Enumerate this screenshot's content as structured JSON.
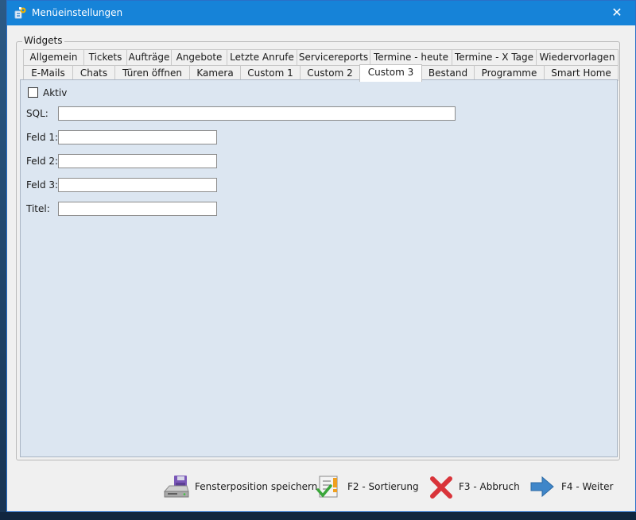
{
  "window": {
    "title": "Menüeinstellungen",
    "close_symbol": "✕"
  },
  "group": {
    "legend": "Widgets"
  },
  "tabs": {
    "row1": [
      "Allgemein",
      "Tickets",
      "Aufträge",
      "Angebote",
      "Letzte Anrufe",
      "Servicereports",
      "Termine - heute",
      "Termine - X Tage",
      "Wiedervorlagen"
    ],
    "row2": [
      "E-Mails",
      "Chats",
      "Türen öffnen",
      "Kamera",
      "Custom 1",
      "Custom 2",
      "Custom 3",
      "Bestand",
      "Programme",
      "Smart Home"
    ],
    "active": "Custom 3"
  },
  "form": {
    "aktiv_label": "Aktiv",
    "aktiv_checked": false,
    "sql_label": "SQL:",
    "sql_value": "",
    "feld1_label": "Feld 1:",
    "feld1_value": "",
    "feld2_label": "Feld 2:",
    "feld2_value": "",
    "feld3_label": "Feld 3:",
    "feld3_value": "",
    "titel_label": "Titel:",
    "titel_value": ""
  },
  "footer": {
    "save_position_label": "Fensterposition speichern",
    "sort_label": "F2 - Sortierung",
    "cancel_label": "F3 - Abbruch",
    "next_label": "F4 - Weiter"
  },
  "colors": {
    "titlebar": "#1683d8",
    "tabpage": "#dce6f1",
    "cancel_red": "#d9343a",
    "next_blue": "#3f86c9"
  },
  "icons": {
    "app": "app-icon",
    "close": "close-icon",
    "save_position": "floppy-drive-icon",
    "sort": "checklist-icon",
    "cancel": "red-x-icon",
    "next": "right-arrow-icon"
  }
}
